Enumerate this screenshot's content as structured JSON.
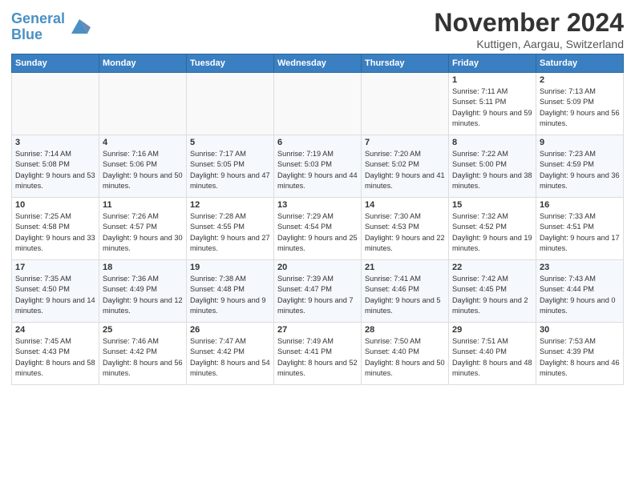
{
  "logo": {
    "line1": "General",
    "line2": "Blue"
  },
  "title": "November 2024",
  "location": "Kuttigen, Aargau, Switzerland",
  "days_of_week": [
    "Sunday",
    "Monday",
    "Tuesday",
    "Wednesday",
    "Thursday",
    "Friday",
    "Saturday"
  ],
  "weeks": [
    [
      {
        "day": "",
        "info": ""
      },
      {
        "day": "",
        "info": ""
      },
      {
        "day": "",
        "info": ""
      },
      {
        "day": "",
        "info": ""
      },
      {
        "day": "",
        "info": ""
      },
      {
        "day": "1",
        "info": "Sunrise: 7:11 AM\nSunset: 5:11 PM\nDaylight: 9 hours and 59 minutes."
      },
      {
        "day": "2",
        "info": "Sunrise: 7:13 AM\nSunset: 5:09 PM\nDaylight: 9 hours and 56 minutes."
      }
    ],
    [
      {
        "day": "3",
        "info": "Sunrise: 7:14 AM\nSunset: 5:08 PM\nDaylight: 9 hours and 53 minutes."
      },
      {
        "day": "4",
        "info": "Sunrise: 7:16 AM\nSunset: 5:06 PM\nDaylight: 9 hours and 50 minutes."
      },
      {
        "day": "5",
        "info": "Sunrise: 7:17 AM\nSunset: 5:05 PM\nDaylight: 9 hours and 47 minutes."
      },
      {
        "day": "6",
        "info": "Sunrise: 7:19 AM\nSunset: 5:03 PM\nDaylight: 9 hours and 44 minutes."
      },
      {
        "day": "7",
        "info": "Sunrise: 7:20 AM\nSunset: 5:02 PM\nDaylight: 9 hours and 41 minutes."
      },
      {
        "day": "8",
        "info": "Sunrise: 7:22 AM\nSunset: 5:00 PM\nDaylight: 9 hours and 38 minutes."
      },
      {
        "day": "9",
        "info": "Sunrise: 7:23 AM\nSunset: 4:59 PM\nDaylight: 9 hours and 36 minutes."
      }
    ],
    [
      {
        "day": "10",
        "info": "Sunrise: 7:25 AM\nSunset: 4:58 PM\nDaylight: 9 hours and 33 minutes."
      },
      {
        "day": "11",
        "info": "Sunrise: 7:26 AM\nSunset: 4:57 PM\nDaylight: 9 hours and 30 minutes."
      },
      {
        "day": "12",
        "info": "Sunrise: 7:28 AM\nSunset: 4:55 PM\nDaylight: 9 hours and 27 minutes."
      },
      {
        "day": "13",
        "info": "Sunrise: 7:29 AM\nSunset: 4:54 PM\nDaylight: 9 hours and 25 minutes."
      },
      {
        "day": "14",
        "info": "Sunrise: 7:30 AM\nSunset: 4:53 PM\nDaylight: 9 hours and 22 minutes."
      },
      {
        "day": "15",
        "info": "Sunrise: 7:32 AM\nSunset: 4:52 PM\nDaylight: 9 hours and 19 minutes."
      },
      {
        "day": "16",
        "info": "Sunrise: 7:33 AM\nSunset: 4:51 PM\nDaylight: 9 hours and 17 minutes."
      }
    ],
    [
      {
        "day": "17",
        "info": "Sunrise: 7:35 AM\nSunset: 4:50 PM\nDaylight: 9 hours and 14 minutes."
      },
      {
        "day": "18",
        "info": "Sunrise: 7:36 AM\nSunset: 4:49 PM\nDaylight: 9 hours and 12 minutes."
      },
      {
        "day": "19",
        "info": "Sunrise: 7:38 AM\nSunset: 4:48 PM\nDaylight: 9 hours and 9 minutes."
      },
      {
        "day": "20",
        "info": "Sunrise: 7:39 AM\nSunset: 4:47 PM\nDaylight: 9 hours and 7 minutes."
      },
      {
        "day": "21",
        "info": "Sunrise: 7:41 AM\nSunset: 4:46 PM\nDaylight: 9 hours and 5 minutes."
      },
      {
        "day": "22",
        "info": "Sunrise: 7:42 AM\nSunset: 4:45 PM\nDaylight: 9 hours and 2 minutes."
      },
      {
        "day": "23",
        "info": "Sunrise: 7:43 AM\nSunset: 4:44 PM\nDaylight: 9 hours and 0 minutes."
      }
    ],
    [
      {
        "day": "24",
        "info": "Sunrise: 7:45 AM\nSunset: 4:43 PM\nDaylight: 8 hours and 58 minutes."
      },
      {
        "day": "25",
        "info": "Sunrise: 7:46 AM\nSunset: 4:42 PM\nDaylight: 8 hours and 56 minutes."
      },
      {
        "day": "26",
        "info": "Sunrise: 7:47 AM\nSunset: 4:42 PM\nDaylight: 8 hours and 54 minutes."
      },
      {
        "day": "27",
        "info": "Sunrise: 7:49 AM\nSunset: 4:41 PM\nDaylight: 8 hours and 52 minutes."
      },
      {
        "day": "28",
        "info": "Sunrise: 7:50 AM\nSunset: 4:40 PM\nDaylight: 8 hours and 50 minutes."
      },
      {
        "day": "29",
        "info": "Sunrise: 7:51 AM\nSunset: 4:40 PM\nDaylight: 8 hours and 48 minutes."
      },
      {
        "day": "30",
        "info": "Sunrise: 7:53 AM\nSunset: 4:39 PM\nDaylight: 8 hours and 46 minutes."
      }
    ]
  ]
}
